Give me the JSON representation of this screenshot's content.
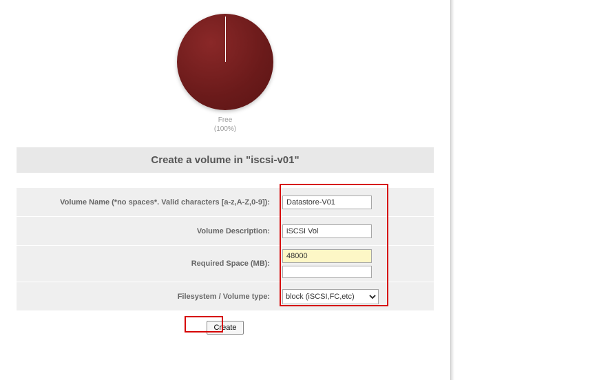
{
  "chart_data": {
    "type": "pie",
    "title": "",
    "series": [
      {
        "name": "Free",
        "value": 100
      }
    ],
    "colors": [
      "#6a1a1a"
    ],
    "label_line1": "Free",
    "label_line2": "(100%)"
  },
  "header": {
    "title": "Create a volume in \"iscsi-v01\""
  },
  "form": {
    "volume_name": {
      "label": "Volume Name (*no spaces*. Valid characters [a-z,A-Z,0-9]):",
      "value": "Datastore-V01"
    },
    "volume_description": {
      "label": "Volume Description:",
      "value": "iSCSI Vol"
    },
    "required_space": {
      "label": "Required Space (MB):",
      "value": "48000"
    },
    "fs_type": {
      "label": "Filesystem / Volume type:",
      "selected": "block (iSCSI,FC,etc)",
      "options": [
        "block (iSCSI,FC,etc)"
      ]
    }
  },
  "buttons": {
    "create": "Create"
  }
}
